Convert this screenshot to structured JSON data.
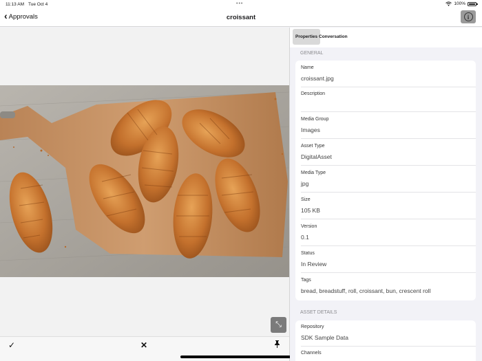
{
  "status_bar": {
    "time": "11:13 AM",
    "date": "Tue Oct 4",
    "battery": "100%"
  },
  "nav": {
    "back_label": "Approvals",
    "title": "croissant"
  },
  "segments": [
    {
      "label": "Properties"
    },
    {
      "label": "Conversation"
    }
  ],
  "sections": {
    "general": {
      "header": "GENERAL",
      "rows": [
        {
          "label": "Name",
          "value": "croissant.jpg"
        },
        {
          "label": "Description",
          "value": ""
        },
        {
          "label": "Media Group",
          "value": "Images"
        },
        {
          "label": "Asset Type",
          "value": "DigitalAsset"
        },
        {
          "label": "Media Type",
          "value": "jpg"
        },
        {
          "label": "Size",
          "value": "105 KB"
        },
        {
          "label": "Version",
          "value": "0.1"
        },
        {
          "label": "Status",
          "value": "In Review"
        },
        {
          "label": "Tags",
          "value": "bread, breadstuff, roll, croissant, bun, crescent roll"
        }
      ]
    },
    "asset_details": {
      "header": "ASSET DETAILS",
      "rows": [
        {
          "label": "Repository",
          "value": "SDK Sample Data"
        },
        {
          "label": "Channels",
          "value": ""
        }
      ]
    }
  },
  "toolbar": {
    "approve_icon": "checkmark-icon",
    "reject_icon": "x-icon",
    "pin_icon": "pin-icon"
  },
  "icons": {
    "info": "info-icon",
    "expand": "expand-icon",
    "back": "chevron-left-icon"
  },
  "colors": {
    "wood": "#c8946a",
    "crust": "#c77a35",
    "table": "#a9a59f"
  }
}
